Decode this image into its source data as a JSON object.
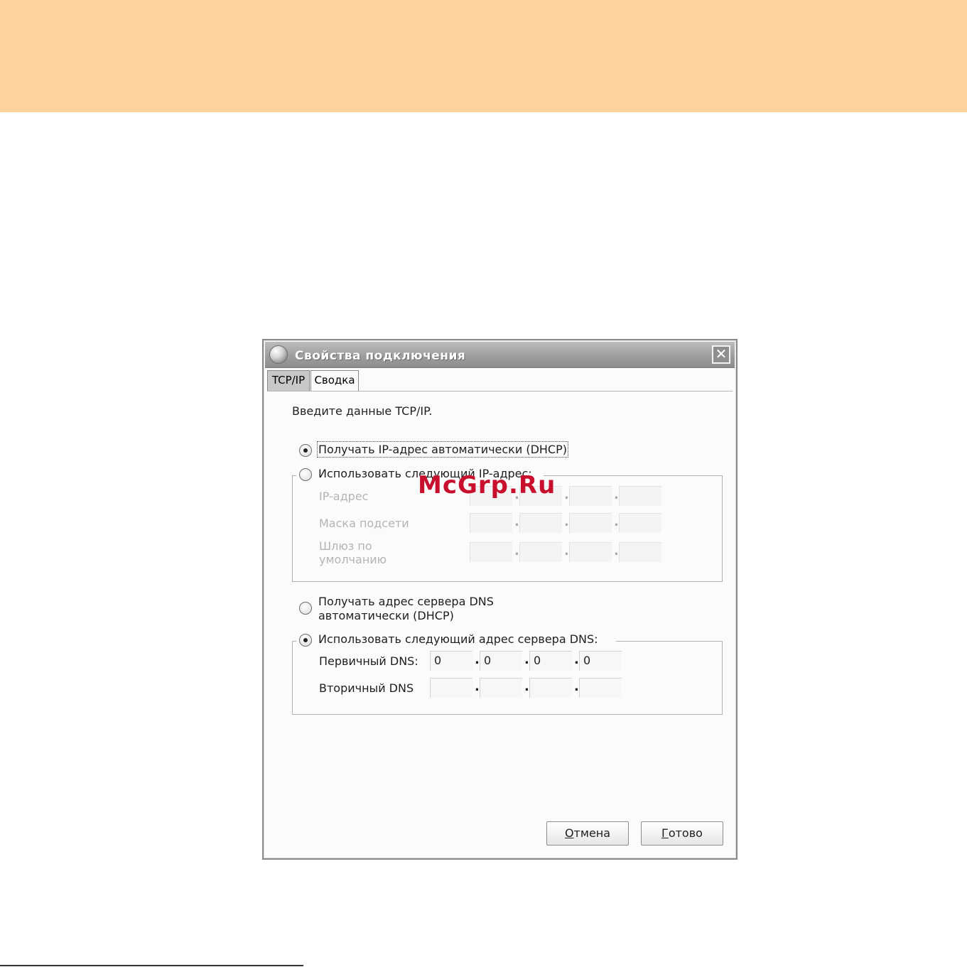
{
  "dialog": {
    "title": "Свойства подключения",
    "close_symbol": "✕",
    "tabs": [
      {
        "label": "TCP/IP",
        "active": true
      },
      {
        "label": "Сводка",
        "active": false
      }
    ],
    "instruction": "Введите данные TCP/IP.",
    "ip_mode": {
      "auto_label": "Получать IP-адрес автоматически (DHCP)",
      "manual_label": "Использовать следующий IP-адрес:",
      "selected": "auto"
    },
    "ip_fields": {
      "ip_address_label": "IP-адрес",
      "subnet_mask_label": "Маска подсети",
      "gateway_label_line1": "Шлюз по",
      "gateway_label_line2": "умолчанию"
    },
    "dns_mode": {
      "auto_label_line1": "Получать адрес сервера DNS",
      "auto_label_line2": "автоматически (DHCP)",
      "manual_label": "Использовать следующий адрес сервера DNS:",
      "selected": "manual"
    },
    "dns_fields": {
      "primary_label": "Первичный DNS:",
      "primary_value": [
        "0",
        "0",
        "0",
        "0"
      ],
      "secondary_label": "Вторичный DNS",
      "secondary_value": [
        "",
        "",
        "",
        ""
      ],
      "separator": "."
    },
    "buttons": {
      "cancel_mnemonic": "О",
      "cancel_rest": "тмена",
      "done_mnemonic": "Г",
      "done_rest": "отово"
    }
  },
  "watermark": "McGrp.Ru"
}
